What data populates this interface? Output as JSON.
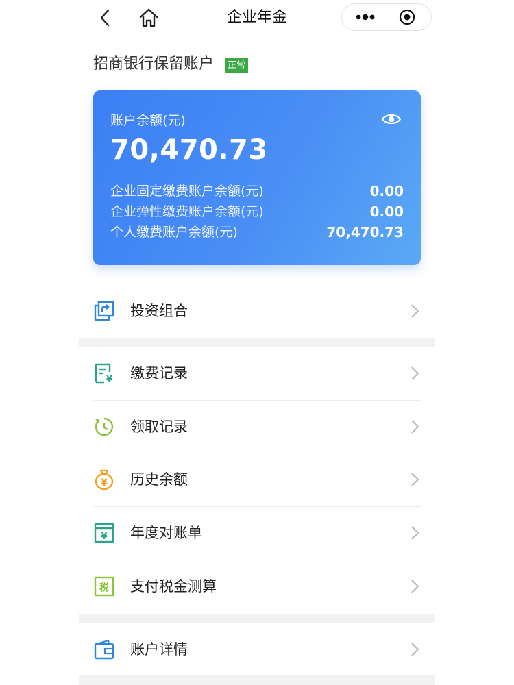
{
  "nav": {
    "title": "企业年金",
    "back_icon": "chevron-left-icon",
    "home_icon": "home-icon",
    "more_icon": "more-dots-icon",
    "close_icon": "target-close-icon"
  },
  "account": {
    "name": "招商银行保留账户",
    "status": "正常",
    "status_color": "#3ba845"
  },
  "card": {
    "balance_label": "账户余额(元)",
    "balance": "70,470.73",
    "eye_icon": "eye-icon",
    "gradient": [
      "#3b7ff5",
      "#5ba9f5"
    ],
    "rows": [
      {
        "label": "企业固定缴费账户余额(元)",
        "value": "0.00"
      },
      {
        "label": "企业弹性缴费账户余额(元)",
        "value": "0.00"
      },
      {
        "label": "个人缴费账户余额(元)",
        "value": "70,470.73"
      }
    ]
  },
  "menu": [
    {
      "label": "投资组合",
      "icon": "portfolio-icon"
    },
    {
      "label": "缴费记录",
      "icon": "payment-record-icon"
    },
    {
      "label": "领取记录",
      "icon": "withdrawal-clock-icon"
    },
    {
      "label": "历史余额",
      "icon": "money-bag-icon",
      "icon_text": "¥"
    },
    {
      "label": "年度对账单",
      "icon": "annual-statement-icon",
      "icon_text": "¥"
    },
    {
      "label": "支付税金测算",
      "icon": "tax-calc-icon",
      "icon_text": "税"
    },
    {
      "label": "账户详情",
      "icon": "wallet-icon"
    }
  ]
}
